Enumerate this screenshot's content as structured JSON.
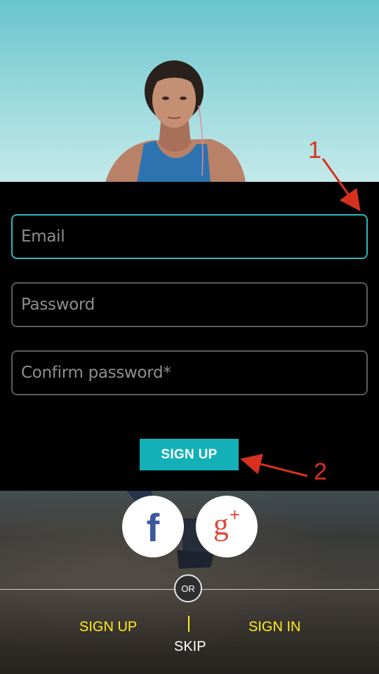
{
  "form": {
    "email_placeholder": "Email",
    "password_placeholder": "Password",
    "confirm_placeholder": "Confirm password*",
    "submit_label": "SIGN UP"
  },
  "social": {
    "facebook_glyph": "f",
    "google_glyph": "g",
    "google_plus": "+"
  },
  "divider": {
    "or_label": "OR"
  },
  "links": {
    "signup_label": "SIGN UP",
    "signin_label": "SIGN IN",
    "skip_label": "SKIP"
  },
  "annotations": {
    "marker_1": "1",
    "marker_2": "2"
  },
  "colors": {
    "accent": "#13b1b7",
    "focus_border": "#2bb8bd",
    "link_yellow": "#ffec1a",
    "annotation_red": "#d8301f",
    "facebook_blue": "#3b5a9a",
    "google_red": "#dd4b39"
  },
  "icons": {
    "facebook": "facebook-icon",
    "google_plus": "google-plus-icon"
  }
}
